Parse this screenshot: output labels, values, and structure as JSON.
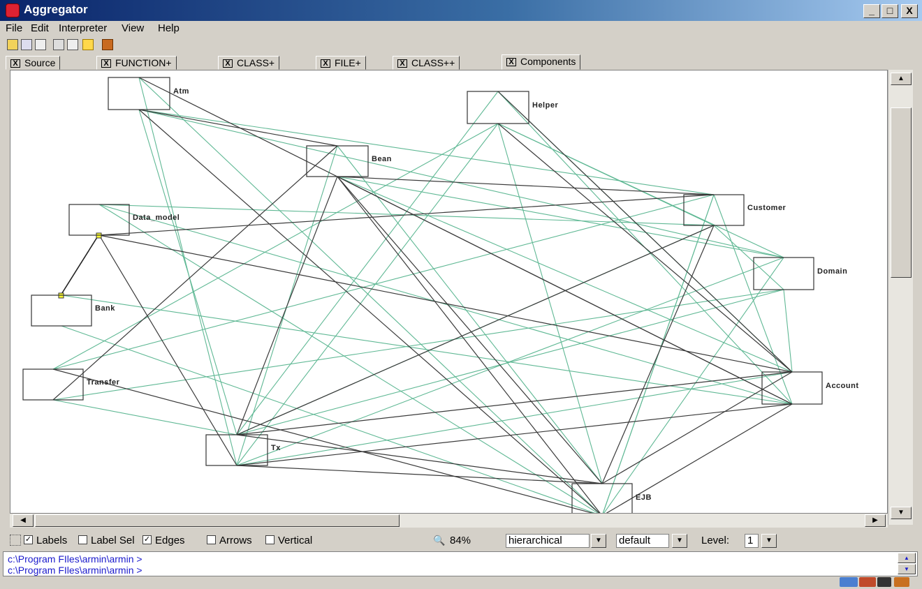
{
  "window": {
    "title": "Aggregator",
    "minimize": "_",
    "maximize": "□",
    "close": "X"
  },
  "menu": {
    "items": [
      "File",
      "Edit",
      "Interpreter",
      "View",
      "Help"
    ]
  },
  "toolbar": {
    "icons": [
      "open-folder-icon",
      "save-icon",
      "print-icon",
      "tree-icon",
      "cut-icon",
      "hand-pointer-icon",
      "book-icon"
    ]
  },
  "tabs": {
    "close_glyph": "X",
    "items": [
      {
        "label": "Source",
        "active": false
      },
      {
        "label": "FUNCTION+",
        "active": false
      },
      {
        "label": "CLASS+",
        "active": false
      },
      {
        "label": "FILE+",
        "active": false
      },
      {
        "label": "CLASS++",
        "active": false
      },
      {
        "label": "Components",
        "active": true
      }
    ]
  },
  "graph": {
    "nodes": [
      {
        "id": "Atm",
        "label": "Atm"
      },
      {
        "id": "Helper",
        "label": "Helper"
      },
      {
        "id": "Bean",
        "label": "Bean"
      },
      {
        "id": "Customer",
        "label": "Customer"
      },
      {
        "id": "Data_model",
        "label": "Data_model"
      },
      {
        "id": "Domain",
        "label": "Domain"
      },
      {
        "id": "Bank",
        "label": "Bank"
      },
      {
        "id": "Transfer",
        "label": "Transfer"
      },
      {
        "id": "Account",
        "label": "Account"
      },
      {
        "id": "Tx",
        "label": "Tx"
      },
      {
        "id": "EJB",
        "label": "EJB"
      }
    ],
    "colors": {
      "dark_edge": "#3a3a3a",
      "green_edge": "#5fb894",
      "node_border": "#333333",
      "handle": "#ffff33"
    }
  },
  "statusbar": {
    "labels_text": "Labels",
    "labels_checked": true,
    "label_sel_text": "Label Sel",
    "label_sel_checked": false,
    "edges_text": "Edges",
    "edges_checked": true,
    "arrows_text": "Arrows",
    "arrows_checked": false,
    "vertical_text": "Vertical",
    "vertical_checked": false,
    "zoom": "84%",
    "layout_value": "hierarchical",
    "style_value": "default",
    "level_label": "Level:",
    "level_value": "1"
  },
  "console": {
    "lines": [
      "c:\\Program FIles\\armin\\armin >",
      "c:\\Program FIles\\armin\\armin >"
    ]
  }
}
